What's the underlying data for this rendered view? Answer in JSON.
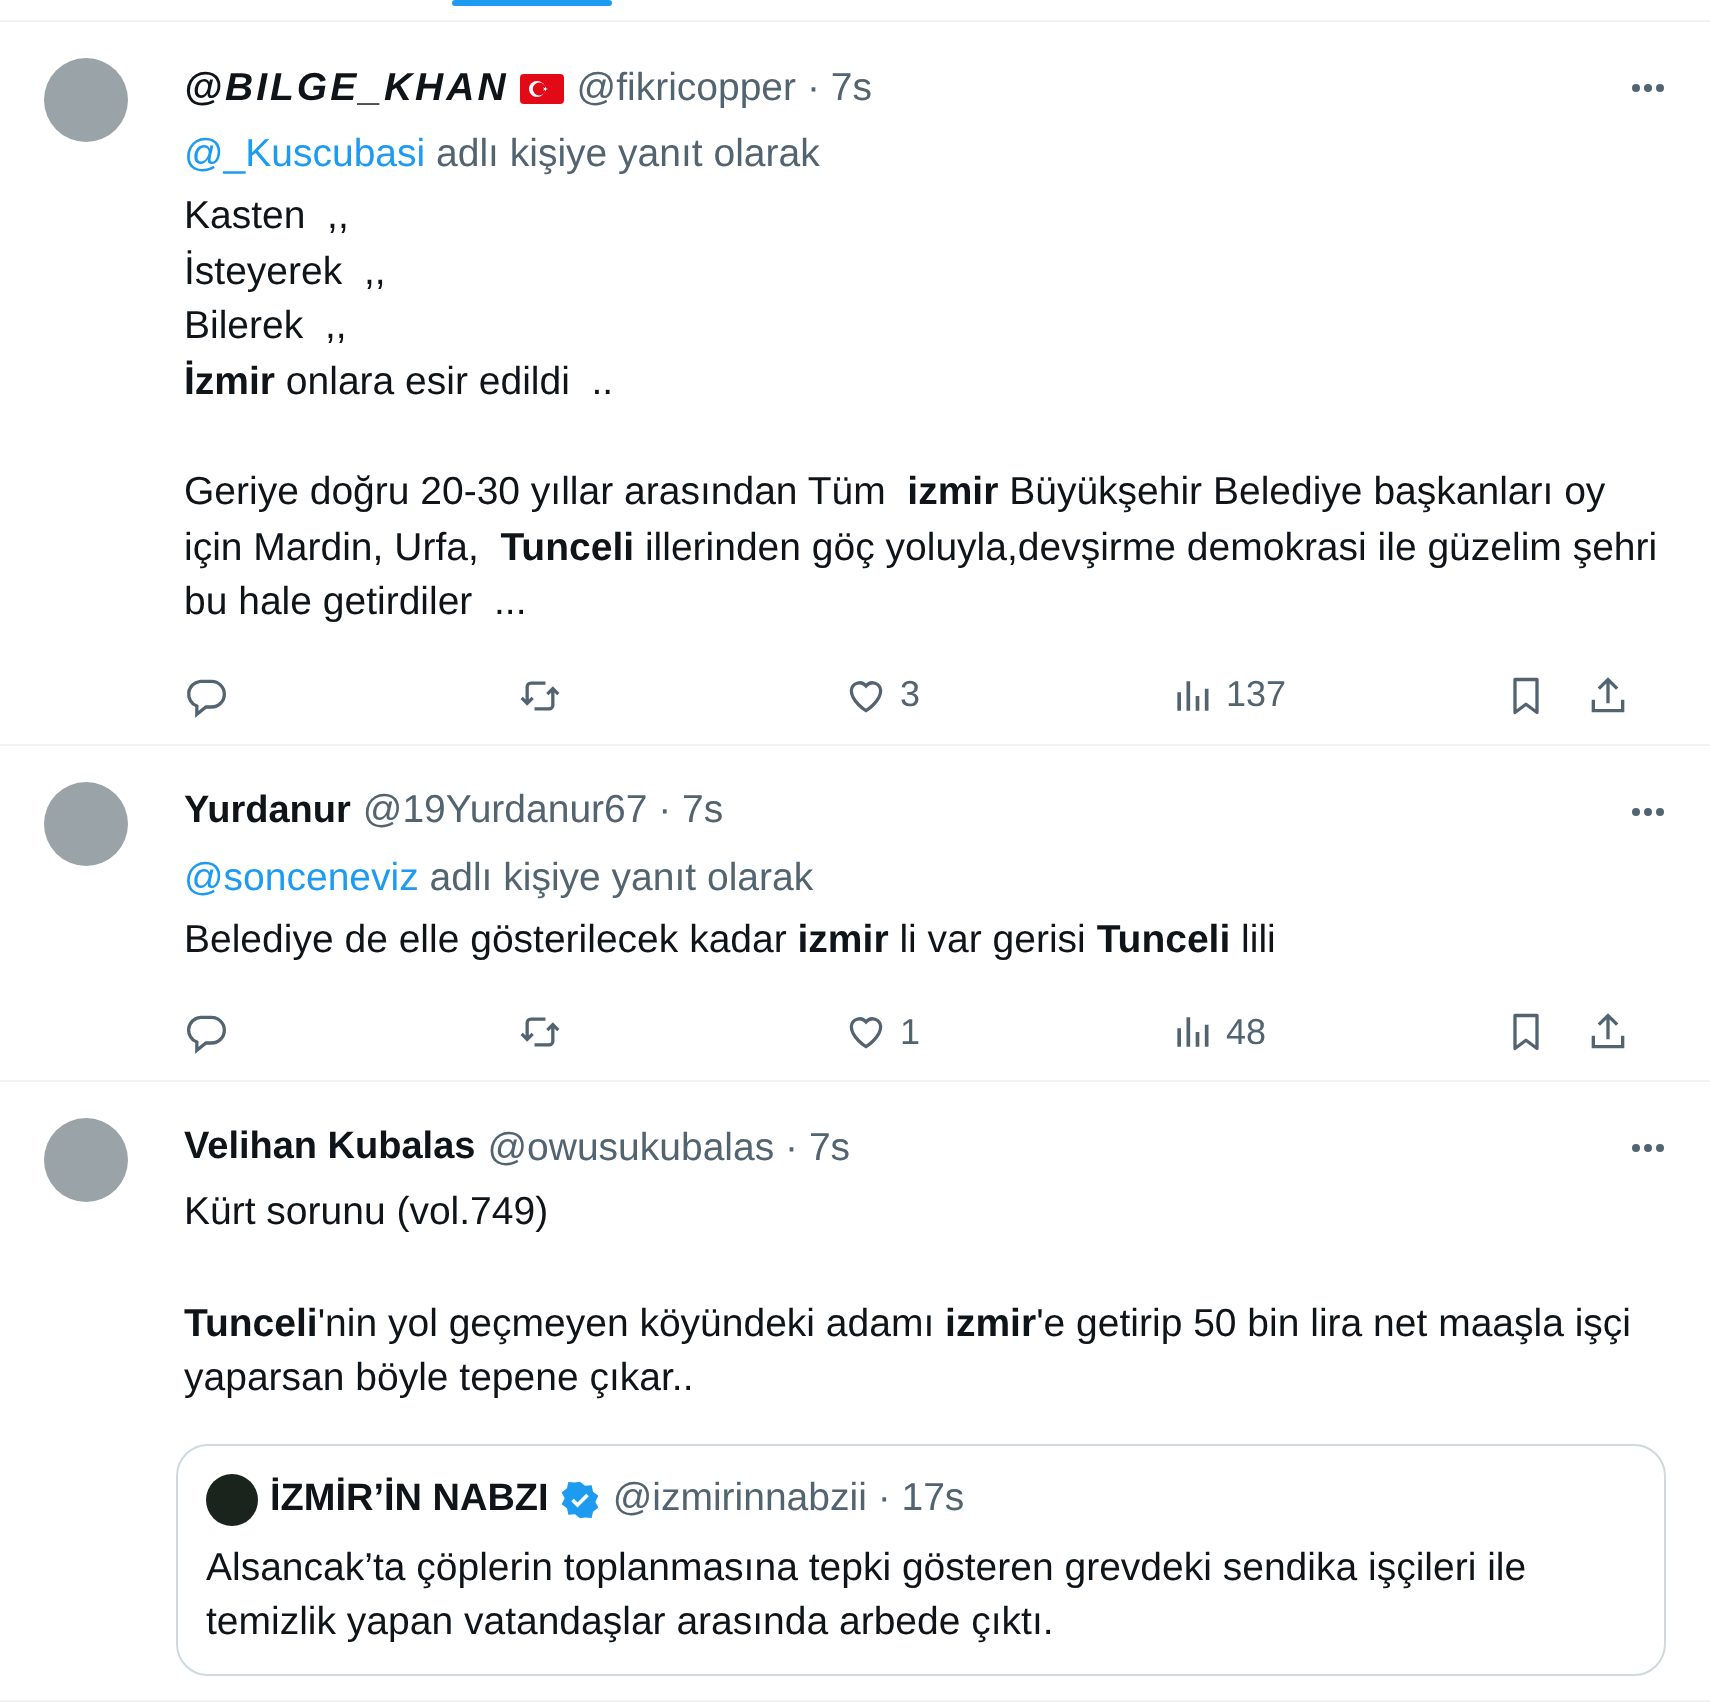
{
  "tweets": [
    {
      "author": "@BILGE_KHAN",
      "italic_name": true,
      "flag": true,
      "meta": "@fikricopper · 7s",
      "reply_to": "@_Kuscubasi",
      "reply_label": "adlı kişiye yanıt olarak",
      "body": [
        "Kasten  ,,\nİsteyerek  ,,\nBilerek  ,,\n**İzmir** onlara esir edildi  ..",
        "Geriye doğru 20-30 yıllar arasından Tüm  **izmir** Büyükşehir Belediye başkanları oy için Mardin, Urfa,  **Tunceli** illerinden göç yoluyla,devşirme demokrasi ile güzelim şehri bu hale getirdiler  ..."
      ],
      "actions": [
        {
          "kind": "reply"
        },
        {
          "kind": "retweet"
        },
        {
          "kind": "like",
          "count": "3"
        },
        {
          "kind": "views",
          "count": "137"
        },
        {
          "kind": "bookmark"
        },
        {
          "kind": "share"
        }
      ]
    },
    {
      "author": "Yurdanur",
      "italic_name": false,
      "meta": "@19Yurdanur67 · 7s",
      "reply_to": "@sonceneviz",
      "reply_label": "adlı kişiye yanıt olarak",
      "body": [
        "Belediye de elle gösterilecek kadar **izmir** li var gerisi **Tunceli** lili"
      ],
      "actions": [
        {
          "kind": "reply"
        },
        {
          "kind": "retweet"
        },
        {
          "kind": "like",
          "count": "1"
        },
        {
          "kind": "views",
          "count": "48"
        },
        {
          "kind": "bookmark"
        },
        {
          "kind": "share"
        }
      ]
    },
    {
      "author": "Velihan Kubalas",
      "italic_name": false,
      "meta": "@owusukubalas · 7s",
      "body": [
        "Kürt sorunu (vol.749)",
        "**Tunceli**'nin yol geçmeyen köyündeki adamı **izmir**'e getirip 50 bin lira net maaşla işçi yaparsan böyle tepene çıkar.."
      ],
      "quote": {
        "author": "İZMİR’İN NABZI",
        "verified": true,
        "meta": "@izmirinnabzii · 17s",
        "text": "Alsancak’ta çöplerin toplanmasına tepki gösteren grevdeki sendika işçileri ile temizlik yapan vatandaşlar arasında arbede çıktı."
      }
    }
  ]
}
